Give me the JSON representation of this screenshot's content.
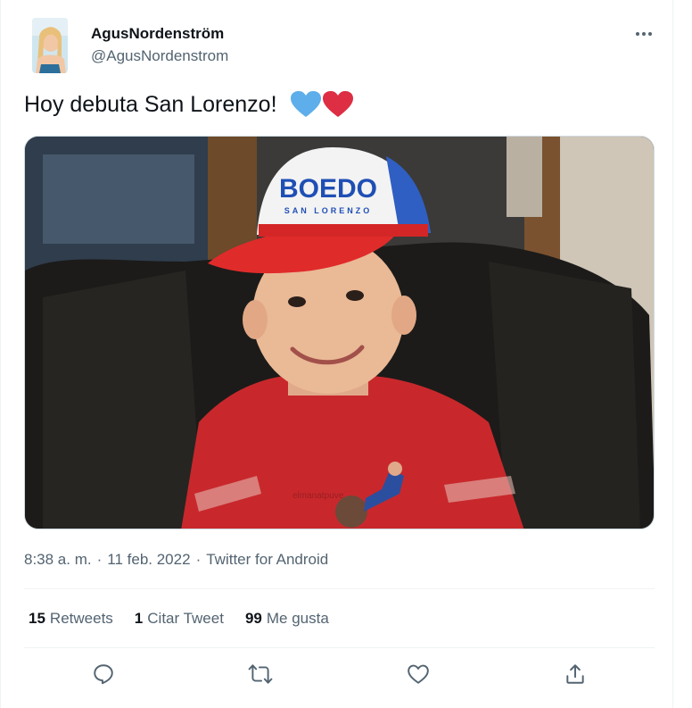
{
  "author": {
    "display_name": "AgusNordenström",
    "username": "@AgusNordenstrom"
  },
  "tweet": {
    "text": "Hoy debuta San Lorenzo!",
    "emojis": [
      "blue-heart-icon",
      "red-heart-icon"
    ]
  },
  "media": {
    "cap_text": "BOEDO",
    "cap_subtext": "SAN LORENZO",
    "watermark": "elmanatpuve"
  },
  "meta": {
    "time": "8:38 a. m.",
    "separator": "·",
    "date": "11 feb. 2022",
    "source": "Twitter for Android"
  },
  "stats": {
    "retweets_count": "15",
    "retweets_label": "Retweets",
    "quotes_count": "1",
    "quotes_label": "Citar Tweet",
    "likes_count": "99",
    "likes_label": "Me gusta"
  },
  "actions": [
    "reply-icon",
    "retweet-icon",
    "like-icon",
    "share-icon"
  ],
  "colors": {
    "text": "#0f1419",
    "secondary": "#536471",
    "border": "#eff3f4",
    "blue_heart": "#5daeea",
    "red_heart": "#dd2e44"
  }
}
